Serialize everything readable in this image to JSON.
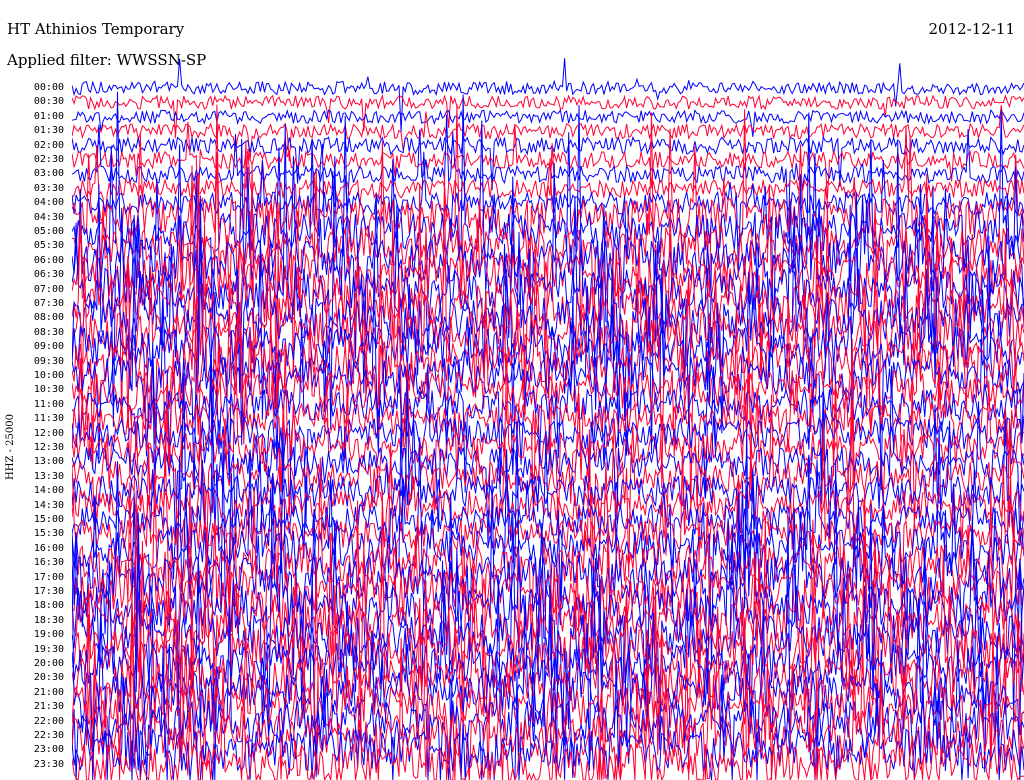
{
  "header": {
    "station": "HT Athinios Temporary",
    "filter": "Applied filter: WWSSN-SP",
    "date": "2012-12-11"
  },
  "chart_data": {
    "type": "helicorder",
    "ylabel": "HHZ - 25000",
    "tick_labels": [
      "00:00",
      "00:30",
      "01:00",
      "01:30",
      "02:00",
      "02:30",
      "03:00",
      "03:30",
      "04:00",
      "04:30",
      "05:00",
      "05:30",
      "06:00",
      "06:30",
      "07:00",
      "07:30",
      "08:00",
      "08:30",
      "09:00",
      "09:30",
      "10:00",
      "10:30",
      "11:00",
      "11:30",
      "12:00",
      "12:30",
      "13:00",
      "13:30",
      "14:00",
      "14:30",
      "15:00",
      "15:30",
      "16:00",
      "16:30",
      "17:00",
      "17:30",
      "18:00",
      "18:30",
      "19:00",
      "19:30",
      "20:00",
      "20:30",
      "21:00",
      "21:30",
      "22:00",
      "22:30",
      "23:00",
      "23:30"
    ],
    "line_colors": [
      "#0000ff",
      "#ff0033"
    ],
    "trace_activity": [
      0.2,
      0.2,
      0.2,
      0.25,
      0.3,
      0.3,
      0.3,
      0.35,
      0.45,
      0.9,
      0.9,
      0.9,
      1.0,
      1.0,
      1.0,
      1.0,
      1.0,
      1.0,
      1.0,
      1.0,
      0.9,
      0.9,
      0.7,
      0.7,
      0.7,
      0.7,
      0.7,
      0.7,
      0.7,
      0.7,
      0.7,
      0.7,
      0.9,
      0.9,
      1.0,
      1.0,
      1.0,
      1.0,
      1.0,
      1.0,
      1.0,
      1.0,
      1.0,
      1.0,
      1.0,
      1.0,
      1.0,
      1.0
    ]
  }
}
